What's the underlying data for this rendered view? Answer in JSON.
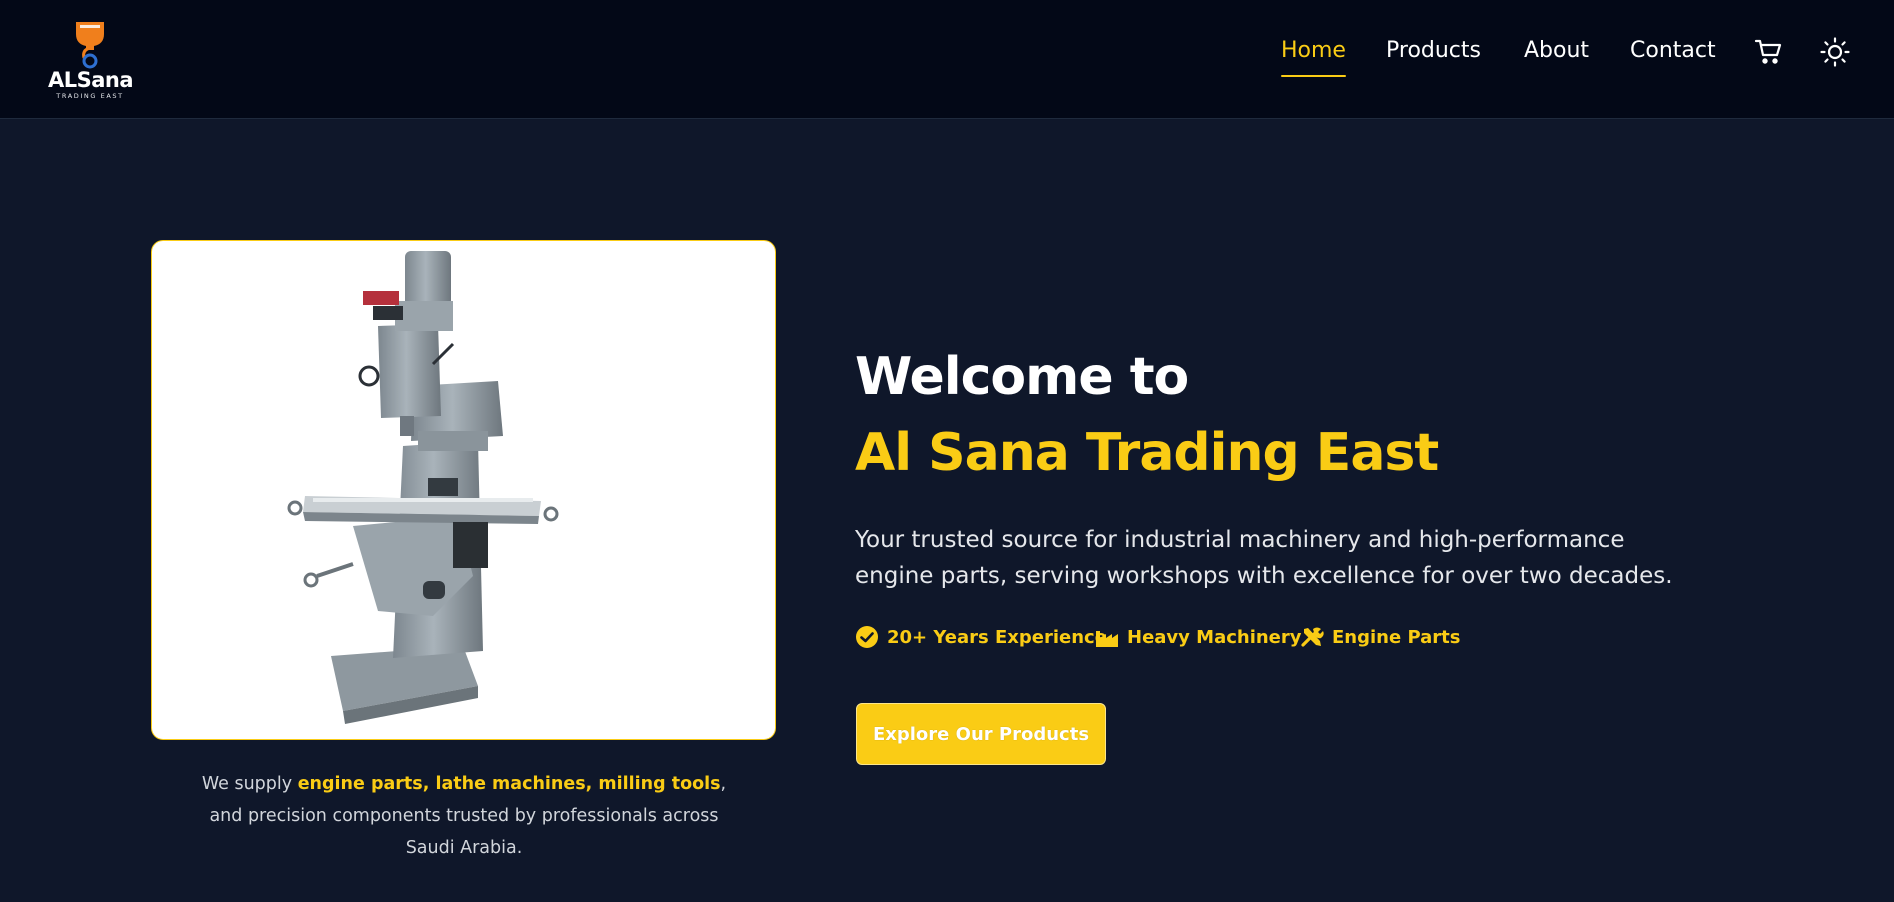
{
  "header": {
    "logo": {
      "name": "ALSana",
      "tagline": "TRADING EAST"
    },
    "nav": [
      {
        "label": "Home",
        "active": true
      },
      {
        "label": "Products",
        "active": false
      },
      {
        "label": "About",
        "active": false
      },
      {
        "label": "Contact",
        "active": false
      }
    ],
    "icons": [
      "cart-icon",
      "sun-icon"
    ]
  },
  "hero": {
    "image": {
      "subject": "milling-machine"
    },
    "caption": {
      "prefix": "We supply ",
      "highlight": "engine parts, lathe machines, milling tools",
      "suffix": ", and precision components trusted by professionals across Saudi Arabia."
    },
    "welcome": "Welcome to",
    "brand": "Al Sana Trading East",
    "description": "Your trusted source for industrial machinery and high-performance engine parts, serving workshops with excellence for over two decades.",
    "features": [
      {
        "label": "20+ Years Experience",
        "icon": "check-circle-icon"
      },
      {
        "label": "Heavy Machinery",
        "icon": "factory-icon"
      },
      {
        "label": "Engine Parts",
        "icon": "tools-icon"
      }
    ],
    "cta": "Explore Our Products"
  },
  "colors": {
    "header_bg": "#030817",
    "page_bg": "#0f172a",
    "accent": "#facc15",
    "text": "#ffffff"
  }
}
